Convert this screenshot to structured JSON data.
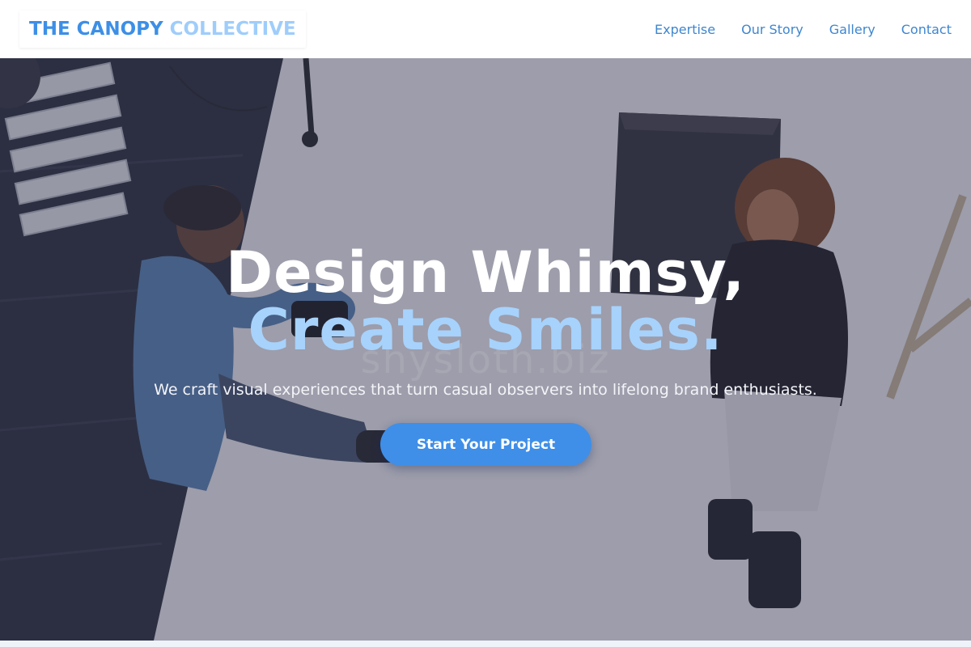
{
  "header": {
    "logo_primary": "THE CANOPY",
    "logo_secondary": "COLLECTIVE",
    "nav": [
      {
        "label": "Expertise"
      },
      {
        "label": "Our Story"
      },
      {
        "label": "Gallery"
      },
      {
        "label": "Contact"
      }
    ]
  },
  "hero": {
    "headline_line1": "Design Whimsy,",
    "headline_line2": "Create Smiles.",
    "subheadline": "We craft visual experiences that turn casual observers into lifelong brand enthusiasts.",
    "cta_label": "Start Your Project",
    "watermark": "shysloth.biz",
    "background_image": "two-people-sitting-on-studio-floor-photo"
  },
  "colors": {
    "accent": "#3d8fe6",
    "accent_light": "#a7d2fb",
    "nav_link": "#3e86cf",
    "cta_bg": "#3f8fe8"
  }
}
